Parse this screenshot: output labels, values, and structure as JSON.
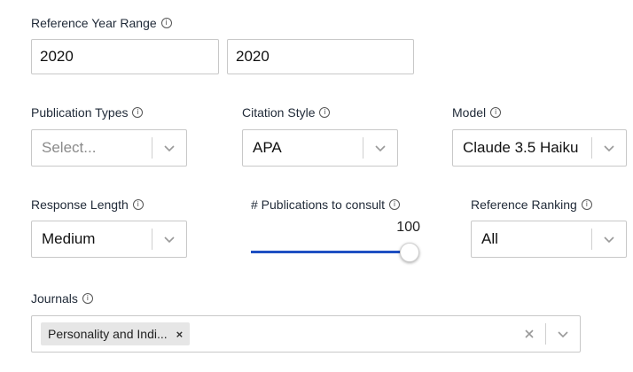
{
  "reference_year_range": {
    "label": "Reference Year Range",
    "start": "2020",
    "end": "2020"
  },
  "publication_types": {
    "label": "Publication Types",
    "placeholder": "Select..."
  },
  "citation_style": {
    "label": "Citation Style",
    "value": "APA"
  },
  "model": {
    "label": "Model",
    "value": "Claude 3.5 Haiku"
  },
  "response_length": {
    "label": "Response Length",
    "value": "Medium"
  },
  "publications_to_consult": {
    "label": "# Publications to consult",
    "value": "100",
    "fraction": 1.0
  },
  "reference_ranking": {
    "label": "Reference Ranking",
    "value": "All"
  },
  "journals": {
    "label": "Journals",
    "chips": [
      {
        "label": "Personality and Indi...",
        "remove": "×"
      }
    ]
  },
  "info_glyph": "i",
  "colors": {
    "slider_accent": "#1e4fc2",
    "border": "#c8c8c8",
    "chip_bg": "#e6e6e6"
  }
}
